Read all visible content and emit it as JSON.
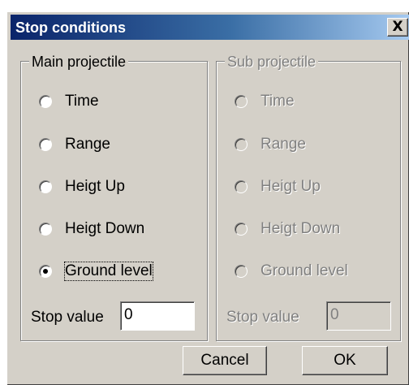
{
  "window": {
    "title": "Stop conditions",
    "close_label": "X"
  },
  "main": {
    "legend": "Main projectile",
    "options": [
      {
        "label": "Time",
        "selected": false
      },
      {
        "label": "Range",
        "selected": false
      },
      {
        "label": "Heigt Up",
        "selected": false
      },
      {
        "label": "Heigt Down",
        "selected": false
      },
      {
        "label": "Ground level",
        "selected": true
      }
    ],
    "stop_label": "Stop value",
    "stop_value": "0"
  },
  "sub": {
    "legend": "Sub projectile",
    "enabled": false,
    "options": [
      {
        "label": "Time",
        "selected": false
      },
      {
        "label": "Range",
        "selected": false
      },
      {
        "label": "Heigt Up",
        "selected": false
      },
      {
        "label": "Heigt Down",
        "selected": false
      },
      {
        "label": "Ground level",
        "selected": false
      }
    ],
    "stop_label": "Stop value",
    "stop_value": "0"
  },
  "buttons": {
    "cancel": "Cancel",
    "ok": "OK"
  }
}
